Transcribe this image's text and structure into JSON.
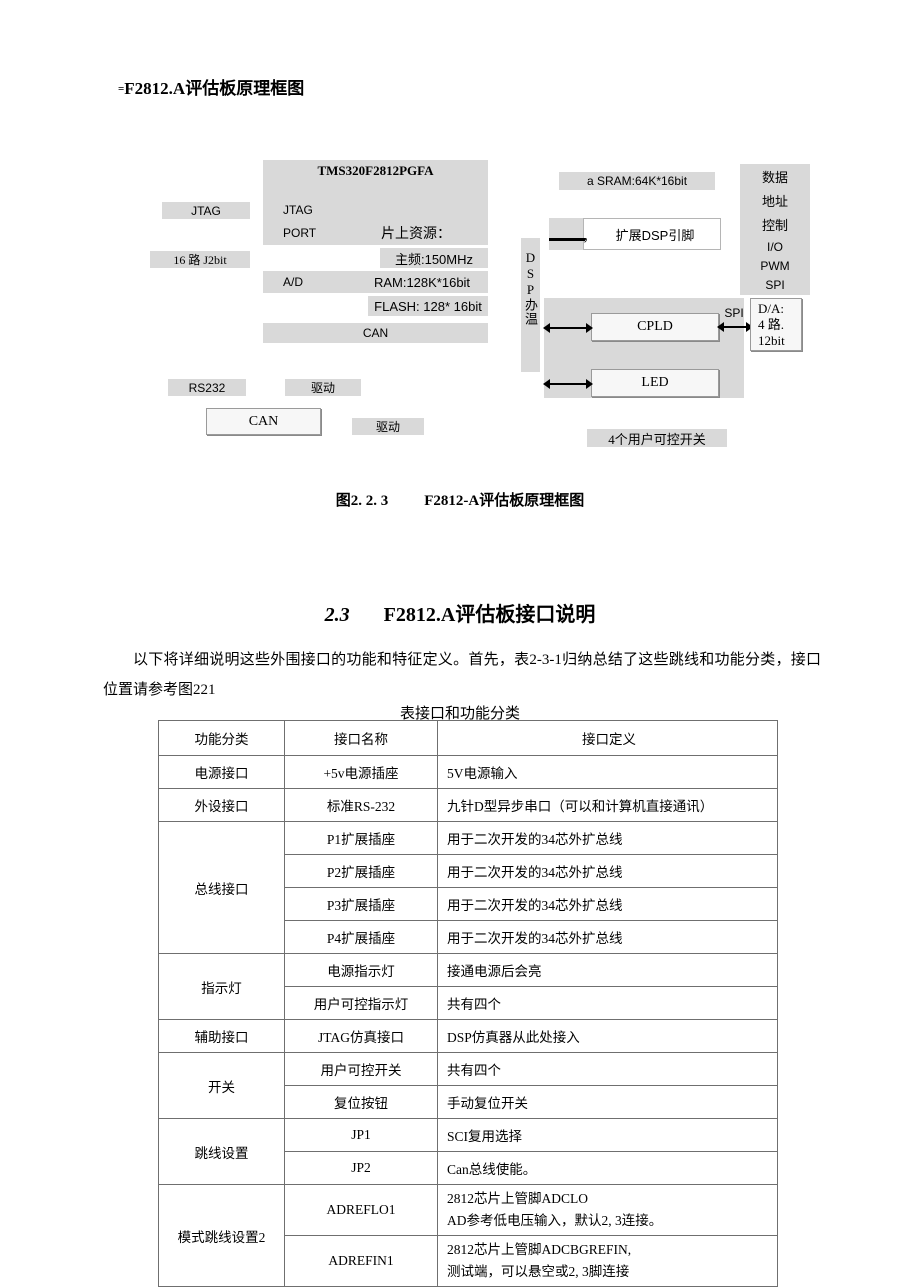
{
  "document": {
    "subtitle_mark": "=",
    "subtitle": "F2812.A评估板原理框图",
    "figure_caption_num": "图2. 2. 3",
    "figure_caption_text": "F2812-A评估板原理框图",
    "section_number": "2.3",
    "section_title": "F2812.A评估板接口说明",
    "paragraph": "以下将详细说明这些外围接口的功能和特征定义。首先，表2-3-1归纳总结了这些跳线和功能分类，接口位置请参考图221",
    "table_title": "表接口和功能分类"
  },
  "diagram": {
    "chip_title": "TMS320F2812PGFA",
    "left_labels": [
      {
        "text": "JTAG"
      },
      {
        "text": "16 路 J2bit"
      },
      {
        "text": "RS232"
      },
      {
        "text": "驱动"
      }
    ],
    "chip_rows": [
      {
        "text": "JTAG"
      },
      {
        "text": "PORT"
      },
      {
        "text": "A/D"
      },
      {
        "text": "CAN"
      }
    ],
    "chip_resources": [
      {
        "text": "片上资源："
      },
      {
        "text": "主频:150MHz"
      },
      {
        "text": "RAM:128K*16bit"
      },
      {
        "text": "FLASH: 128* 16bit"
      }
    ],
    "can_box": "CAN",
    "drive_box": "驱动",
    "vertical_bar": "DSP办温",
    "sram_label": "a SRAM:64K*16bit",
    "expand_pin_label": "扩展DSP引脚",
    "expand_pin_comma": "，",
    "bus_list": [
      "数据",
      "地址",
      "控制",
      "I/O",
      "PWM",
      "SPI"
    ],
    "cpld_box": "CPLD",
    "led_box": "LED",
    "spi_label": "SPI",
    "da_box": [
      "D/A:",
      "4 路.",
      "12bit"
    ],
    "switch_label": "4个用户可控开关"
  },
  "table": {
    "headers": [
      "功能分类",
      "接口名称",
      "接口定义"
    ],
    "rows": [
      {
        "category": "电源接口",
        "rowspan": 1,
        "name": "+5v电源插座",
        "def": [
          "5V电源输入"
        ]
      },
      {
        "category": "外设接口",
        "rowspan": 1,
        "name": "标准RS-232",
        "def": [
          "九针D型异步串口（可以和计算机直接通讯）"
        ]
      },
      {
        "category": "总线接口",
        "rowspan": 4,
        "name": "P1扩展插座",
        "def": [
          "用于二次开发的34芯外扩总线"
        ]
      },
      {
        "category": null,
        "name": "P2扩展插座",
        "def": [
          "用于二次开发的34芯外扩总线"
        ]
      },
      {
        "category": null,
        "name": "P3扩展插座",
        "def": [
          "用于二次开发的34芯外扩总线"
        ]
      },
      {
        "category": null,
        "name": "P4扩展插座",
        "def": [
          "用于二次开发的34芯外扩总线"
        ]
      },
      {
        "category": "指示灯",
        "rowspan": 2,
        "name": "电源指示灯",
        "def": [
          "接通电源后会亮"
        ]
      },
      {
        "category": null,
        "name": "用户可控指示灯",
        "def": [
          "共有四个"
        ]
      },
      {
        "category": "辅助接口",
        "rowspan": 1,
        "name": "JTAG仿真接口",
        "def": [
          "DSP仿真器从此处接入"
        ]
      },
      {
        "category": "开关",
        "rowspan": 2,
        "name": "用户可控开关",
        "def": [
          "共有四个"
        ]
      },
      {
        "category": null,
        "name": "复位按钮",
        "def": [
          "手动复位开关"
        ]
      },
      {
        "category": "跳线设置",
        "rowspan": 2,
        "name": "JP1",
        "def": [
          "SCI复用选择"
        ]
      },
      {
        "category": null,
        "name": "JP2",
        "def": [
          "Can总线使能。"
        ]
      },
      {
        "category": "模式跳线设置2",
        "rowspan": 2,
        "name": "ADREFLO1",
        "def": [
          "2812芯片上管脚ADCLO",
          "AD参考低电压输入，默认2, 3连接。"
        ]
      },
      {
        "category": null,
        "name": "ADREFIN1",
        "def": [
          "2812芯片上管脚ADCBGREFIN,",
          "测试端，可以悬空或2, 3脚连接"
        ]
      }
    ]
  },
  "colors": {
    "grey_fill": "#d9d9d9",
    "box_fill": "#f7f7f7",
    "border": "#6f6f6f",
    "text": "#000000"
  }
}
